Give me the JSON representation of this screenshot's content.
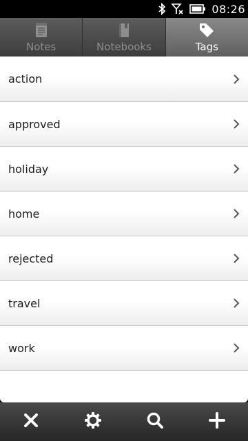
{
  "status_bar": {
    "time": "08:26",
    "icons": [
      "bluetooth-icon",
      "signal-off-icon",
      "battery-icon"
    ]
  },
  "tabs": [
    {
      "label": "Notes",
      "icon": "notes-icon",
      "active": false
    },
    {
      "label": "Notebooks",
      "icon": "notebook-icon",
      "active": false
    },
    {
      "label": "Tags",
      "icon": "tag-icon",
      "active": true
    }
  ],
  "tags": [
    "action",
    "approved",
    "holiday",
    "home",
    "rejected",
    "travel",
    "work"
  ],
  "toolbar": {
    "buttons": [
      "close-icon",
      "settings-icon",
      "search-icon",
      "add-icon"
    ]
  },
  "colors": {
    "active_tab_text": "#ffffff",
    "inactive_tab_text": "#8e8e8e",
    "list_text": "#1a1a1a"
  }
}
